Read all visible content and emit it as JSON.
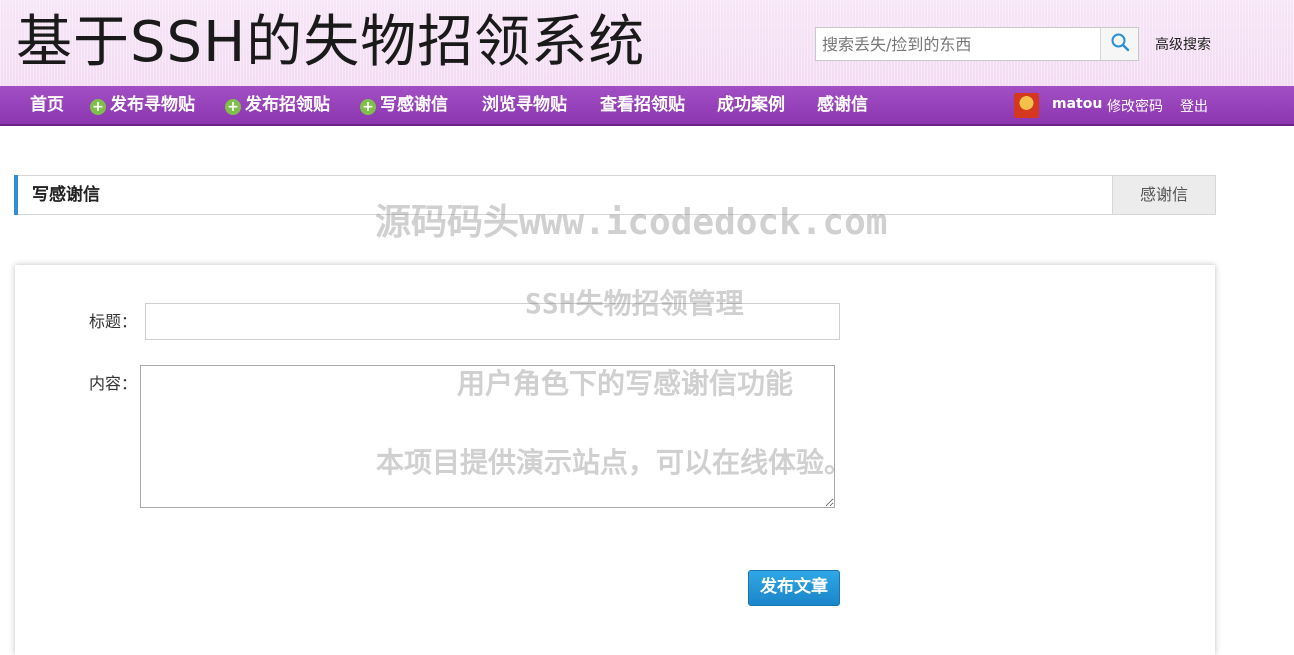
{
  "header": {
    "site_title": "基于SSH的失物招领系统",
    "search_placeholder": "搜索丢失/捡到的东西",
    "advanced_search": "高级搜索"
  },
  "nav": {
    "items": [
      {
        "label": "首页",
        "plus": false
      },
      {
        "label": "发布寻物贴",
        "plus": true
      },
      {
        "label": "发布招领贴",
        "plus": true
      },
      {
        "label": "写感谢信",
        "plus": true
      },
      {
        "label": "浏览寻物贴",
        "plus": false
      },
      {
        "label": "查看招领贴",
        "plus": false
      },
      {
        "label": "成功案例",
        "plus": false
      },
      {
        "label": "感谢信",
        "plus": false
      }
    ],
    "user": {
      "name": "matou",
      "change_password": "修改密码",
      "logout": "登出"
    }
  },
  "breadcrumb": {
    "title": "写感谢信",
    "tab": "感谢信"
  },
  "form": {
    "title_label": "标题：",
    "title_value": "",
    "content_label": "内容：",
    "content_value": "",
    "submit_label": "发布文章"
  },
  "watermarks": {
    "line1": "源码码头www.icodedock.com",
    "line2": "SSH失物招领管理",
    "line3": "用户角色下的写感谢信功能",
    "line4": "本项目提供演示站点，可以在线体验。"
  },
  "colors": {
    "nav_bg": "#9a45bd",
    "accent": "#2f8fdc",
    "button": "#1b86c9",
    "plus_icon": "#7fc04a"
  }
}
